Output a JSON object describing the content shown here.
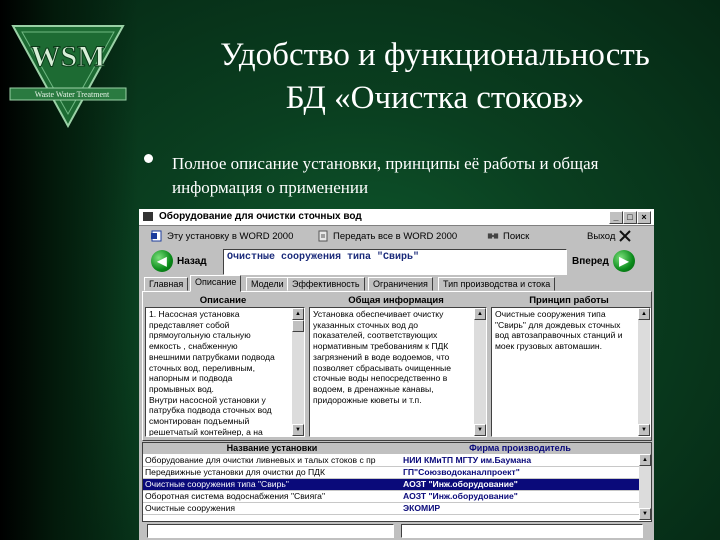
{
  "logo": {
    "letters": "WSM",
    "ribbon": "Waste Water Treatment"
  },
  "slide": {
    "title_line1": "Удобство и функциональность",
    "title_line2": "БД «Очистка стоков»",
    "bullet_text": "Полное описание установки, принципы её работы  и общая информация о применении"
  },
  "window": {
    "title": "Оборудование для очистки сточных вод",
    "controls": [
      "_",
      "□",
      "×"
    ]
  },
  "toolbar": {
    "word_label": "Эту установку в WORD 2000",
    "word_all_label": "Передать все в WORD 2000",
    "search_label": "Поиск",
    "exit_label": "Выход"
  },
  "nav": {
    "back_label": "Назад",
    "forward_label": "Вперед",
    "current_name": "Очистные сооружения типа \"Свирь\""
  },
  "tabs": [
    "Главная",
    "Описание",
    "Модели",
    "Эффективность",
    "Ограничения",
    "Тип производства и стока"
  ],
  "active_tab": "Описание",
  "columns": {
    "description": {
      "header": "Описание",
      "text": "1. Насосная установка\nпредставляет собой\nпрямоугольную стальную\nемкость , снабженную\nвнешними патрубками подвода\nсточных вод, переливным,\nнапорным и подвода\nпромывных вод.\nВнутри насосной установки у\nпатрубка подвода сточных вод\nсмонтирован подъемный\nрешетчатый контейнер, а на\nподводе промывных вод"
    },
    "general": {
      "header": "Общая информация",
      "text": "Установка обеспечивает очистку\nуказанных сточных вод до\nпоказателей, соответствующих\nнормативным требованиям к ПДК\nзагрязнений в воде водоемов, что\nпозволяет сбрасывать очищенные\nсточные воды непосредственно в\nводоем, в дренажные канавы,\nпридорожные кюветы и т.п."
    },
    "principle": {
      "header": "Принцип работы",
      "text": "Очистные сооружения типа\n\"Свирь\" для дождевых сточных\nвод автозаправочных станций и\nмоек грузовых автомашин."
    }
  },
  "table": {
    "headers": [
      "Название установки",
      "Фирма производитель"
    ],
    "rows": [
      {
        "name": "Оборудование для очистки ливневых и талых стоков с пр",
        "maker": "НИИ КМиТП МГТУ им.Баумана",
        "selected": false
      },
      {
        "name": "Передвижные установки для очистки до ПДК",
        "maker": "ГП\"Союзводоканалпроект\"",
        "selected": false
      },
      {
        "name": "Очистные сооружения типа \"Свирь\"",
        "maker": "АОЗТ \"Инж.оборудование\"",
        "selected": true
      },
      {
        "name": "Оборотная система водоснабжения \"Свияга\"",
        "maker": "АОЗТ \"Инж.оборудование\"",
        "selected": false
      },
      {
        "name": "Очистные сооружения",
        "maker": "ЭКОМИР",
        "selected": false
      }
    ]
  },
  "colors": {
    "selection": "#0a0a7a",
    "nav_green": "#0a8a1a",
    "slide_bg": "#0a3f20"
  }
}
